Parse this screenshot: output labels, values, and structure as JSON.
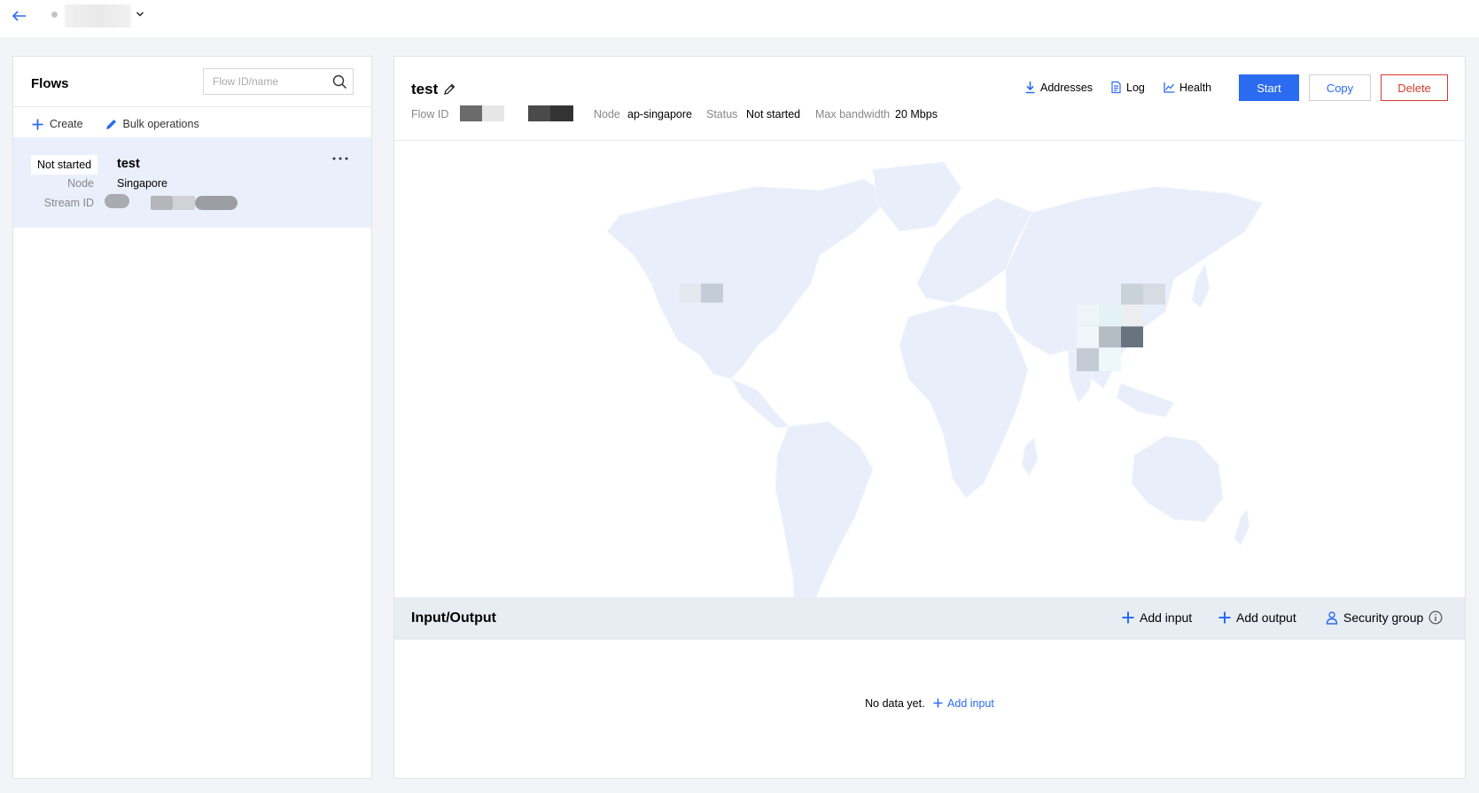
{
  "colors": {
    "accent": "#2b6bef",
    "danger": "#d43b2f",
    "selected_row": "#eaf0fb",
    "map_land": "#e8eefa"
  },
  "topbar": {
    "back_icon": "arrow-left-icon",
    "dropdown_icon": "chevron-down-icon"
  },
  "flows_panel": {
    "title": "Flows",
    "search_placeholder": "Flow ID/name",
    "create_label": "Create",
    "bulk_label": "Bulk operations",
    "items": [
      {
        "status": "Not started",
        "name": "test",
        "node_key": "Node",
        "node_value": "Singapore",
        "stream_key": "Stream ID"
      }
    ]
  },
  "detail": {
    "title": "test",
    "flow_id_key": "Flow ID",
    "node_key": "Node",
    "node_value": "ap-singapore",
    "status_key": "Status",
    "status_value": "Not started",
    "bandwidth_key": "Max bandwidth",
    "bandwidth_value": "20 Mbps",
    "links": {
      "addresses": "Addresses",
      "log": "Log",
      "health": "Health"
    },
    "buttons": {
      "start": "Start",
      "copy": "Copy",
      "delete": "Delete"
    }
  },
  "io": {
    "title": "Input/Output",
    "add_input": "Add input",
    "add_output": "Add output",
    "security_group": "Security group",
    "empty_text": "No data yet.",
    "empty_link": "Add input"
  }
}
